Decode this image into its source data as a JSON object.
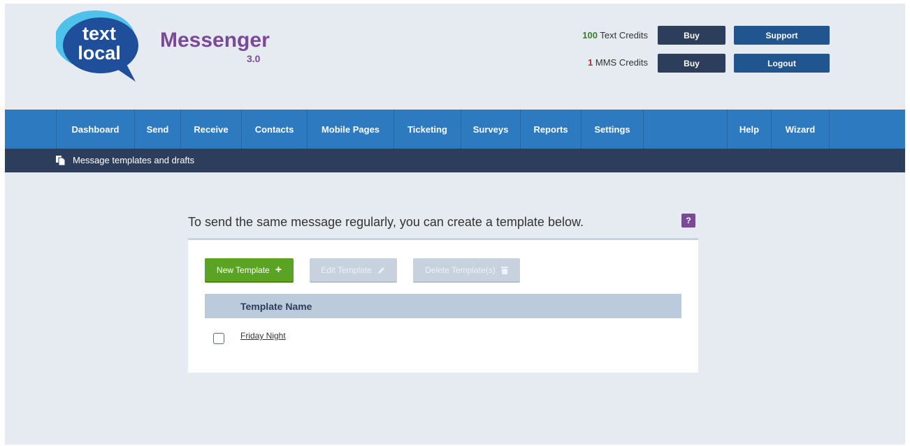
{
  "brand": {
    "logo_line1": "text",
    "logo_line2": "local",
    "name": "Messenger",
    "version": "3.0"
  },
  "credits": {
    "text_count": "100",
    "text_label": "Text Credits",
    "mms_count": "1",
    "mms_label": "MMS Credits",
    "buy_label": "Buy"
  },
  "header_buttons": {
    "support": "Support",
    "logout": "Logout"
  },
  "nav": {
    "dashboard": "Dashboard",
    "send": "Send",
    "receive": "Receive",
    "contacts": "Contacts",
    "mobile_pages": "Mobile Pages",
    "ticketing": "Ticketing",
    "surveys": "Surveys",
    "reports": "Reports",
    "settings": "Settings",
    "help": "Help",
    "wizard": "Wizard"
  },
  "breadcrumb": {
    "icon": "document-icon",
    "text": "Message templates and drafts"
  },
  "intro": "To send the same message regularly, you can create a template below.",
  "help_badge": "?",
  "toolbar": {
    "new_label": "New Template",
    "new_icon": "+",
    "edit_label": "Edit Template",
    "delete_label": "Delete Template(s)"
  },
  "table": {
    "header": "Template Name",
    "rows": [
      {
        "name": "Friday Night",
        "checked": false
      }
    ]
  },
  "colors": {
    "nav": "#2e7ac1",
    "subbar": "#2d3e5c",
    "brand": "#7b4a96",
    "new_button": "#5aa324",
    "disabled_button": "#c7d2de"
  }
}
